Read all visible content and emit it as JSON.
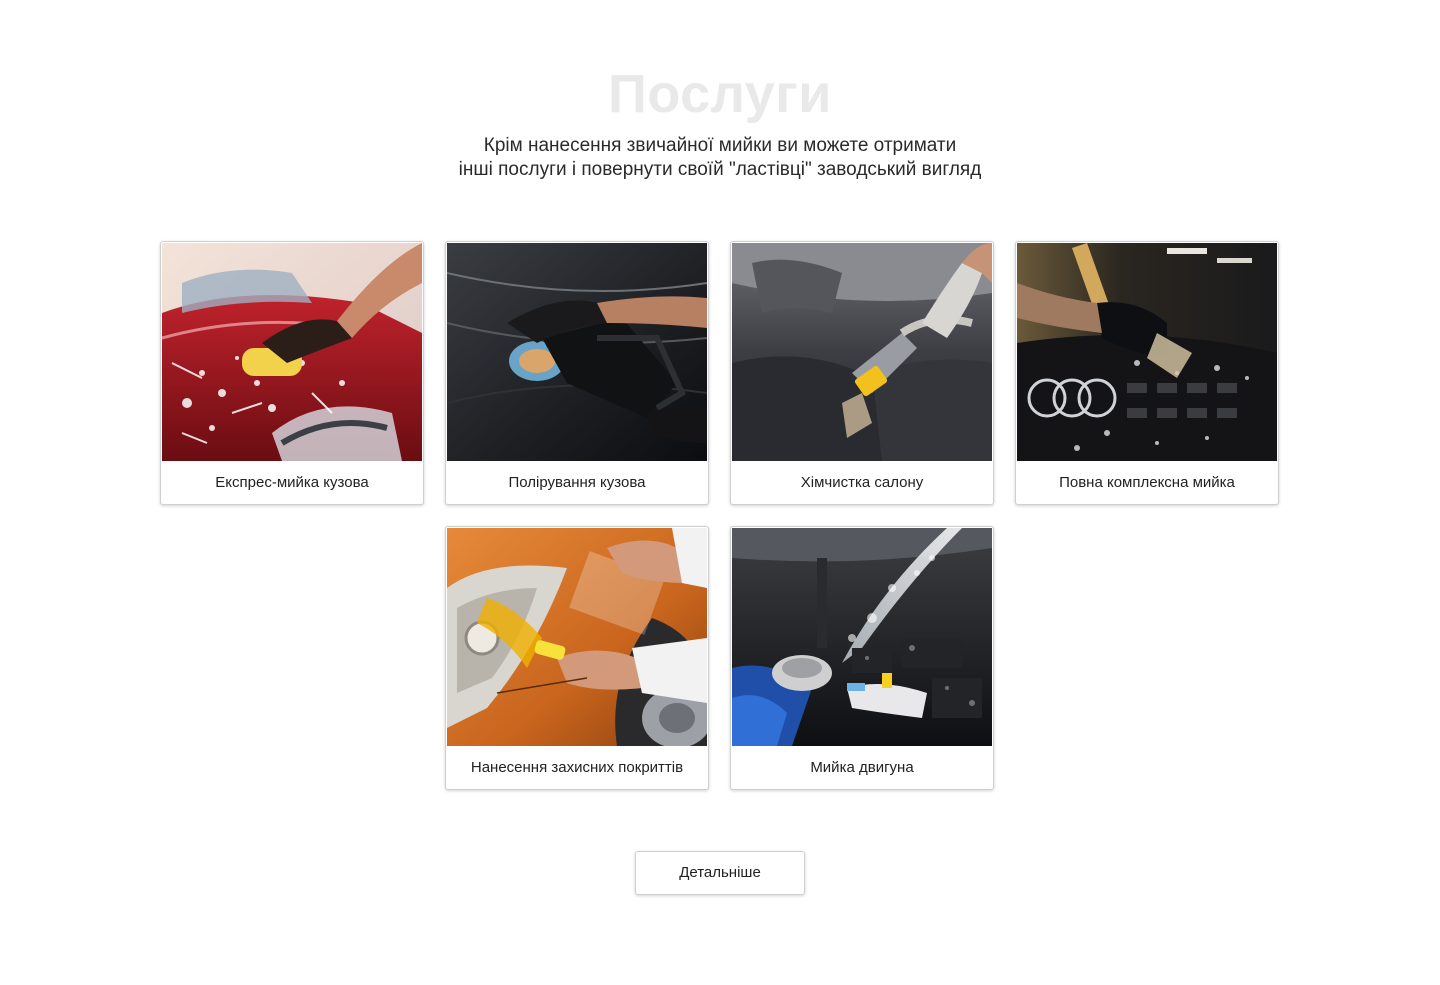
{
  "section": {
    "title": "Послуги",
    "subtitle_line1": "Крім нанесення звичайної мийки ви можете отримати",
    "subtitle_line2": "інші послуги і повернути своїй \"ластівці\" заводський вигляд"
  },
  "services": [
    {
      "label": "Експрес-мийка кузова",
      "image": "car-wash-sponge-photo"
    },
    {
      "label": "Полірування кузова",
      "image": "car-polishing-photo"
    },
    {
      "label": "Хімчистка салону",
      "image": "interior-cleaning-photo"
    },
    {
      "label": "Повна комплексна мийка",
      "image": "full-wash-brush-photo"
    },
    {
      "label": "Нанесення захисних покриттів",
      "image": "protective-film-photo"
    },
    {
      "label": "Мийка двигуна",
      "image": "engine-wash-photo"
    }
  ],
  "more_button": {
    "label": "Детальніше"
  }
}
